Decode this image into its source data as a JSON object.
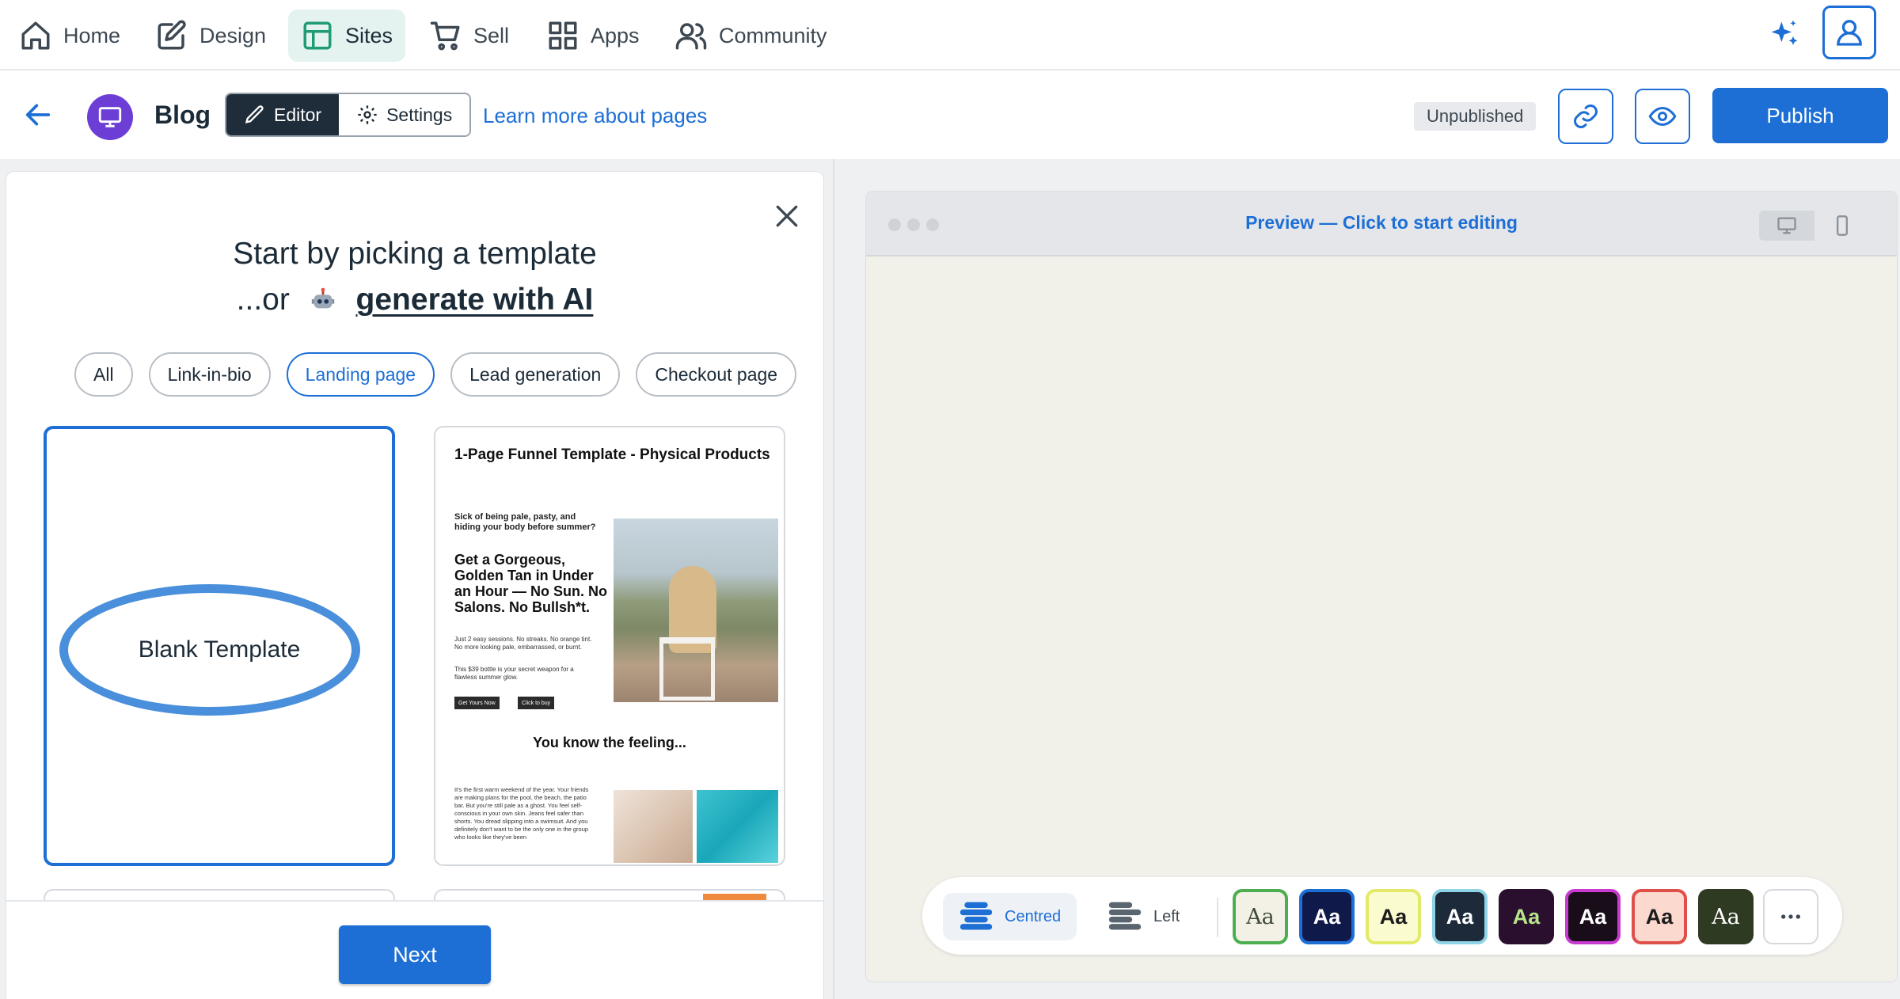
{
  "nav": {
    "items": [
      {
        "label": "Home",
        "icon": "home-icon"
      },
      {
        "label": "Design",
        "icon": "pencil-square-icon"
      },
      {
        "label": "Sites",
        "icon": "layout-icon",
        "active": true
      },
      {
        "label": "Sell",
        "icon": "cart-icon"
      },
      {
        "label": "Apps",
        "icon": "grid-icon"
      },
      {
        "label": "Community",
        "icon": "users-icon"
      }
    ],
    "active_color": "#1f9b76",
    "sparkle_icon": "sparkle-icon",
    "account_icon": "user-icon"
  },
  "header": {
    "page_name": "Blog",
    "editor_label": "Editor",
    "settings_label": "Settings",
    "learn_more": "Learn more about pages",
    "status": "Unpublished",
    "publish_label": "Publish",
    "brand_color": "#1d6fd6"
  },
  "template_picker": {
    "title": "Start by picking a template",
    "subtitle_prefix": "...or",
    "ai_link": "generate with AI",
    "filters": [
      {
        "label": "All",
        "selected": false
      },
      {
        "label": "Link-in-bio",
        "selected": false
      },
      {
        "label": "Landing page",
        "selected": true
      },
      {
        "label": "Lead generation",
        "selected": false
      },
      {
        "label": "Checkout page",
        "selected": false
      }
    ],
    "blank_label": "Blank Template",
    "funnel": {
      "title": "1-Page Funnel Template - Physical Products",
      "lead": "Sick of being pale, pasty, and hiding your body before summer?",
      "headline": "Get a Gorgeous, Golden Tan in Under an Hour — No Sun. No Salons. No Bullsh*t.",
      "body": "Just 2 easy sessions. No streaks. No orange tint. No more looking pale, embarrassed, or burnt.",
      "body2": "This $39 bottle is your secret weapon for a flawless summer glow.",
      "btn1": "Get Yours Now",
      "btn2": "Click to buy",
      "subhead": "You know the feeling...",
      "body3": "It's the first warm weekend of the year. Your friends are making plans for the pool, the beach, the patio bar. But you're still pale as a ghost. You feel self-conscious in your own skin. Jeans feel safer than shorts. You dread slipping into a swimsuit. And you definitely don't want to be the only one in the group who looks like they've been"
    },
    "next_label": "Next"
  },
  "preview": {
    "title": "Preview — Click to start editing",
    "desktop_icon": "desktop-icon",
    "mobile_icon": "mobile-icon",
    "canvas_color": "#f1f1ea"
  },
  "toolbar": {
    "centred_label": "Centred",
    "left_label": "Left",
    "theme_sample": "Aa",
    "themes": [
      {
        "bg": "#f3f0e6",
        "fg": "#3d4a3a",
        "border": "#4cae4f",
        "serif": true
      },
      {
        "bg": "#101a4a",
        "fg": "#ffffff",
        "border": "#1d6fd6",
        "serif": false
      },
      {
        "bg": "#fbfbd0",
        "fg": "#1c1c1c",
        "border": "#e3ea6a",
        "serif": false
      },
      {
        "bg": "#1c2a3a",
        "fg": "#ffffff",
        "border": "#8fd3e6",
        "serif": false
      },
      {
        "bg": "#2a0f2f",
        "fg": "#b7e58a",
        "border": "#2a0f2f",
        "serif": false
      },
      {
        "bg": "#1a0d1a",
        "fg": "#ffffff",
        "border": "#c93ad1",
        "serif": false
      },
      {
        "bg": "#fbd9cf",
        "fg": "#1c1c1c",
        "border": "#e0504a",
        "serif": false
      },
      {
        "bg": "#2f3a22",
        "fg": "#ffffff",
        "border": "#2f3a22",
        "serif": true
      }
    ],
    "more_icon": "more-horizontal-icon"
  }
}
